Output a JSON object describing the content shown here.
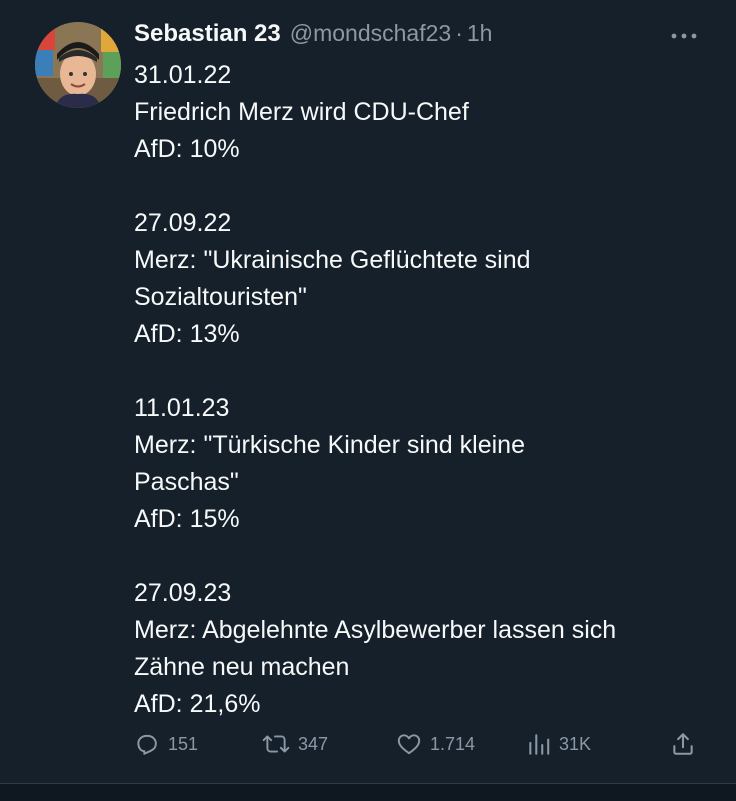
{
  "author": {
    "display_name": "Sebastian 23",
    "handle": "@mondschaf23",
    "separator": "·",
    "time": "1h"
  },
  "icons": {
    "avatar": "profile-photo",
    "more": "more-horizontal-icon",
    "reply": "reply-bubble-icon",
    "retweet": "retweet-icon",
    "like": "heart-icon",
    "views": "analytics-bars-icon",
    "share": "share-upload-icon"
  },
  "tweet": {
    "blocks": [
      {
        "date": "31.01.22",
        "text_lines": [
          "Friedrich Merz wird CDU-Chef"
        ],
        "poll": "AfD: 10%"
      },
      {
        "date": "27.09.22",
        "text_lines": [
          "Merz: \"Ukrainische Geflüchtete sind",
          "Sozialtouristen\""
        ],
        "poll": "AfD: 13%"
      },
      {
        "date": "11.01.23",
        "text_lines": [
          "Merz: \"Türkische Kinder sind kleine",
          "Paschas\""
        ],
        "poll": "AfD: 15%"
      },
      {
        "date": "27.09.23",
        "text_lines": [
          "Merz: Abgelehnte Asylbewerber lassen sich",
          "Zähne neu machen"
        ],
        "poll": "AfD: 21,6%"
      }
    ]
  },
  "actions": {
    "replies": "151",
    "retweets": "347",
    "likes": "1.714",
    "views": "31K"
  },
  "colors": {
    "background": "#15202b",
    "text_primary": "#f7f9f9",
    "text_secondary": "#8b98a5"
  }
}
